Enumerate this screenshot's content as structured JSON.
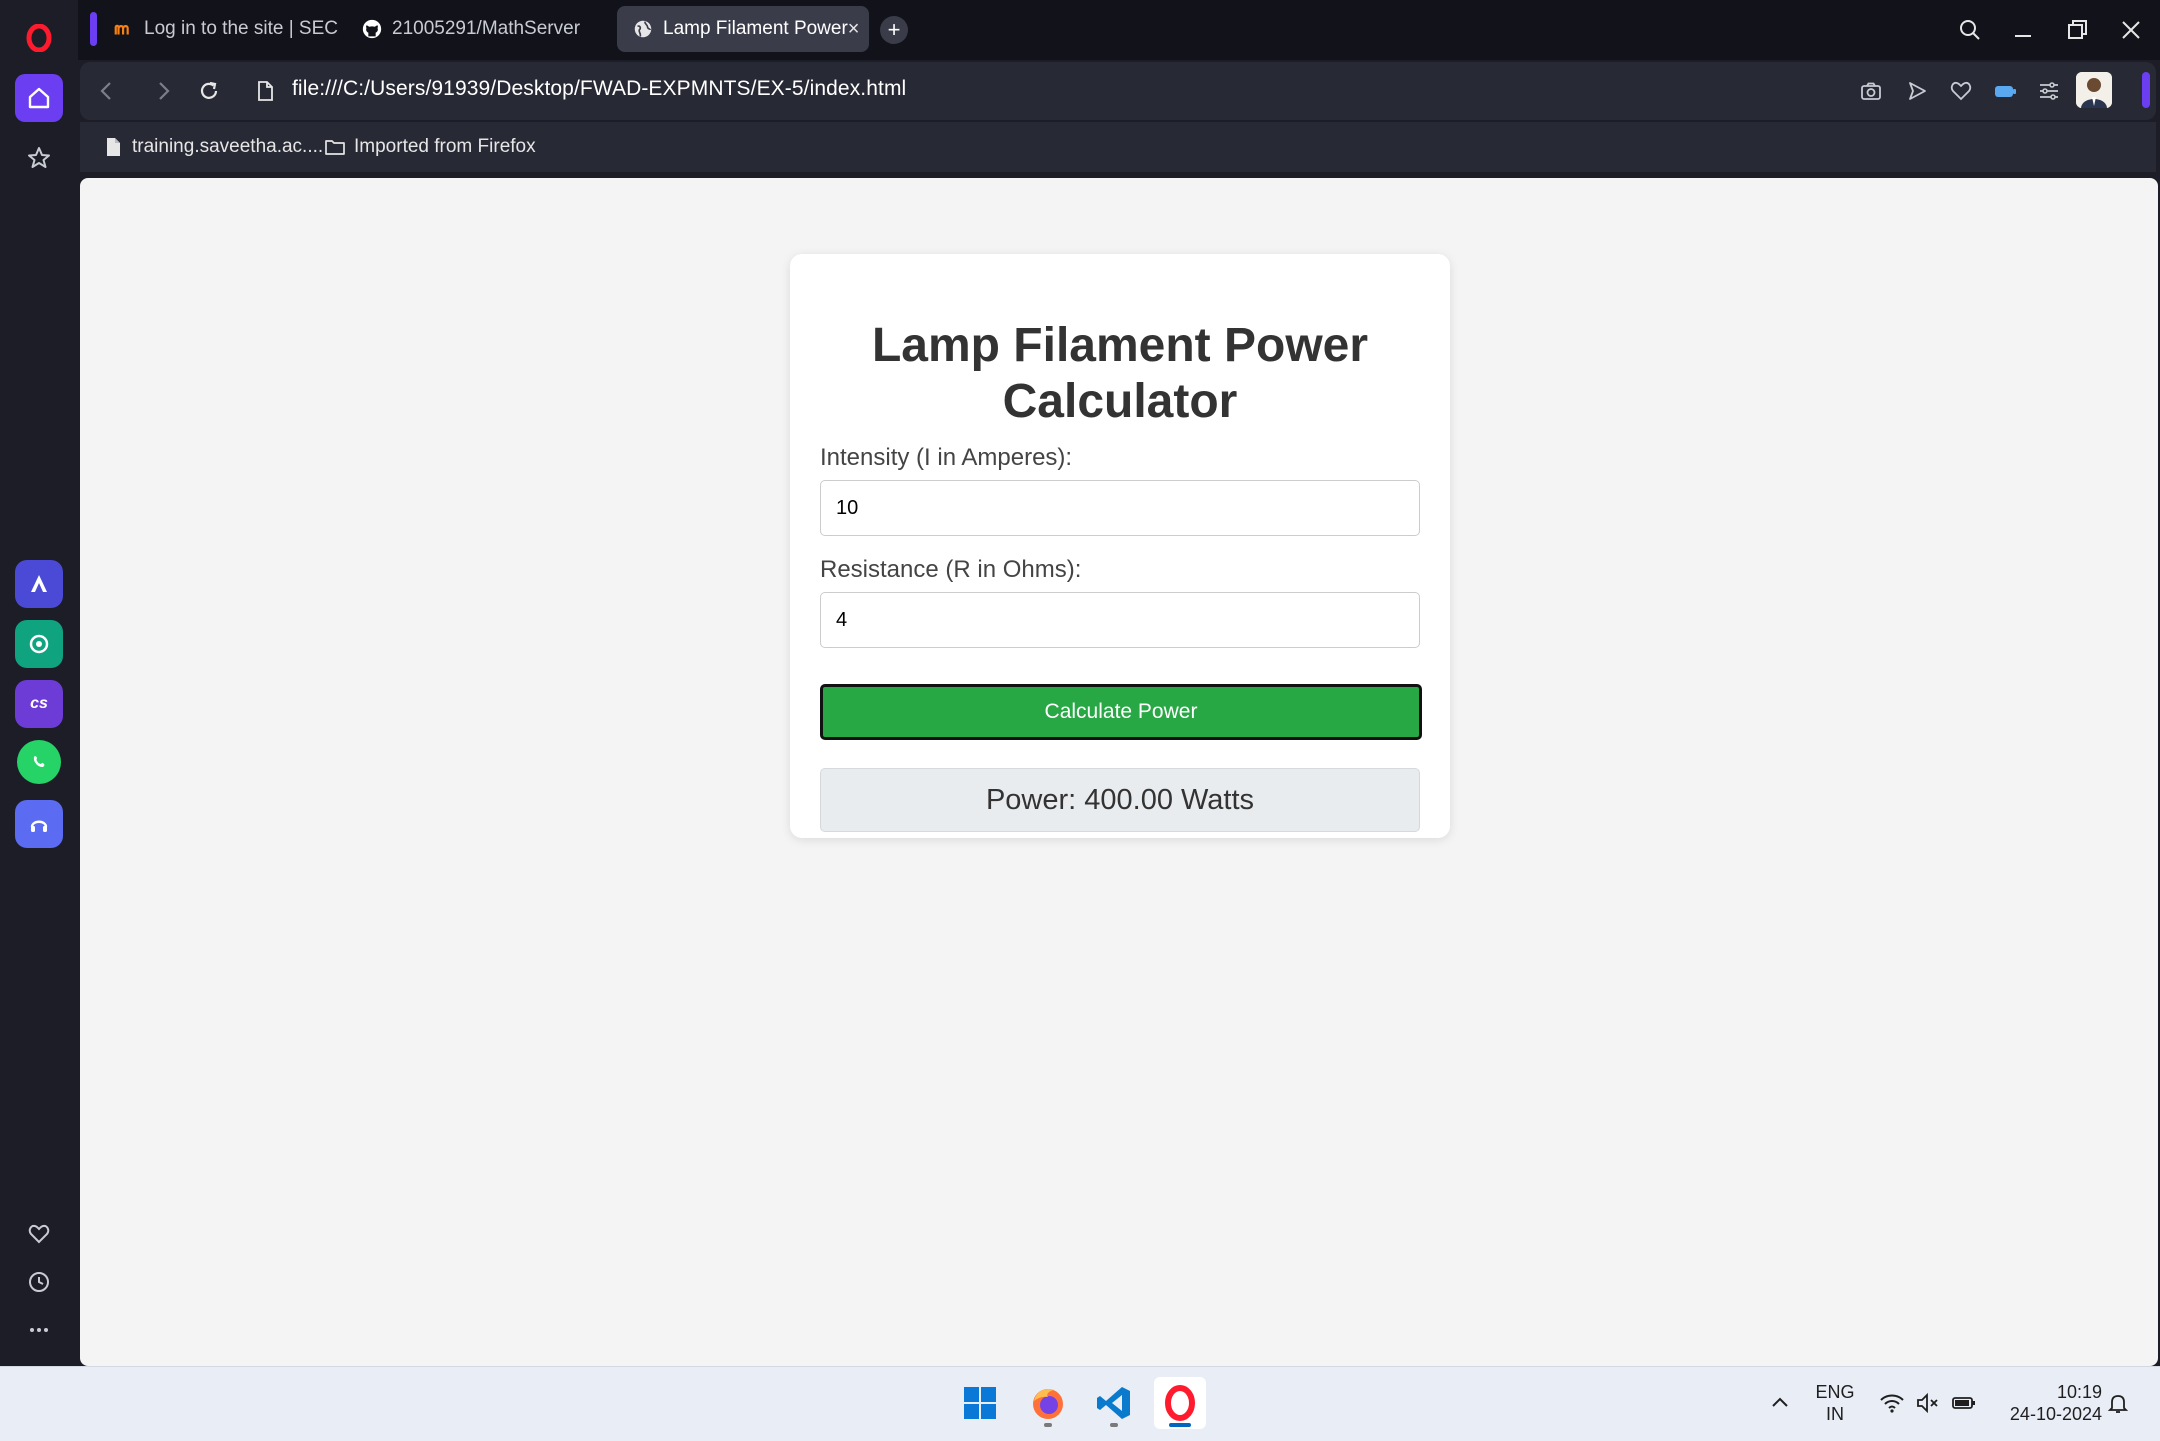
{
  "browser": {
    "tabs": [
      {
        "label": "Log in to the site | SEC",
        "active": false
      },
      {
        "label": "21005291/MathServer",
        "active": false
      },
      {
        "label": "Lamp Filament Power",
        "active": true
      }
    ],
    "tab_close": "×",
    "new_tab": "+",
    "url": "file:///C:/Users/91939/Desktop/FWAD-EXPMNTS/EX-5/index.html",
    "bookmarks": [
      {
        "label": "training.saveetha.ac...."
      },
      {
        "label": "Imported from Firefox"
      }
    ],
    "sidebar_apps": [
      "aria-icon",
      "chatgpt-icon",
      "cs-icon",
      "whatsapp-icon",
      "music-player-icon"
    ],
    "cs_label": "cs",
    "accent_color": "#6b3ef2"
  },
  "page": {
    "title": "Lamp Filament Power Calculator",
    "intensity_label": "Intensity (I in Amperes):",
    "intensity_value": "10",
    "resistance_label": "Resistance (R in Ohms):",
    "resistance_value": "4",
    "button_label": "Calculate Power",
    "result": "Power: 400.00 Watts",
    "button_color": "#28a745"
  },
  "taskbar": {
    "apps": [
      "windows-start-icon",
      "firefox-icon",
      "vscode-icon",
      "opera-icon"
    ],
    "language": "ENG",
    "region": "IN",
    "time": "10:19",
    "date": "24-10-2024"
  }
}
